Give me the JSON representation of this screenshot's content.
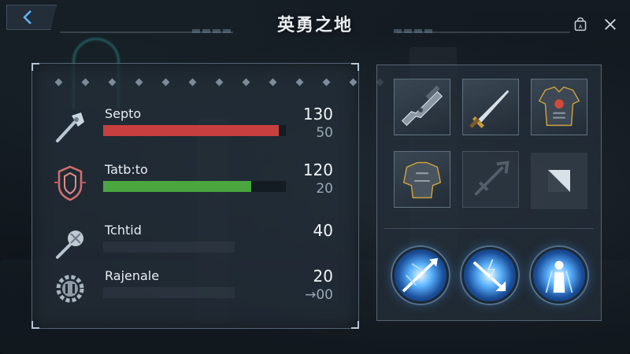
{
  "header": {
    "title": "英勇之地",
    "back_icon": "chevron-left-icon",
    "shop_icon": "bag-icon",
    "close_icon": "close-icon"
  },
  "stats": [
    {
      "name": "Septo",
      "value": "130",
      "sub": "50",
      "fill": 0.96,
      "fill_color": "#c7403f",
      "icon": "battle-axe-icon"
    },
    {
      "name": "Tatb:to",
      "value": "120",
      "sub": "20",
      "fill": 0.81,
      "fill_color": "#4aa63f",
      "icon": "shield-emblem-icon"
    },
    {
      "name": "Tchtid",
      "value": "40",
      "sub": "",
      "fill": 0.72,
      "fill_color": "",
      "icon": "mace-icon"
    },
    {
      "name": "Rajenale",
      "value": "20",
      "sub": "→00",
      "fill": 0.72,
      "fill_color": "",
      "icon": "gear-icon"
    }
  ],
  "equipment": [
    {
      "icon": "rifle-icon",
      "state": "equipped"
    },
    {
      "icon": "dagger-icon",
      "state": "equipped"
    },
    {
      "icon": "armor-icon",
      "state": "equipped"
    },
    {
      "icon": "pauldron-armor-icon",
      "state": "equipped"
    },
    {
      "icon": "spear-silhouette-icon",
      "state": "locked"
    },
    {
      "icon": "empty-slot-icon",
      "state": "empty"
    }
  ],
  "skills": [
    {
      "icon": "spear-strike-skill-icon"
    },
    {
      "icon": "lightning-arrow-skill-icon"
    },
    {
      "icon": "summon-figure-skill-icon"
    }
  ],
  "colors": {
    "accent_red": "#c7403f",
    "accent_green": "#4aa63f",
    "skill_blue": "#5cb3ff"
  }
}
